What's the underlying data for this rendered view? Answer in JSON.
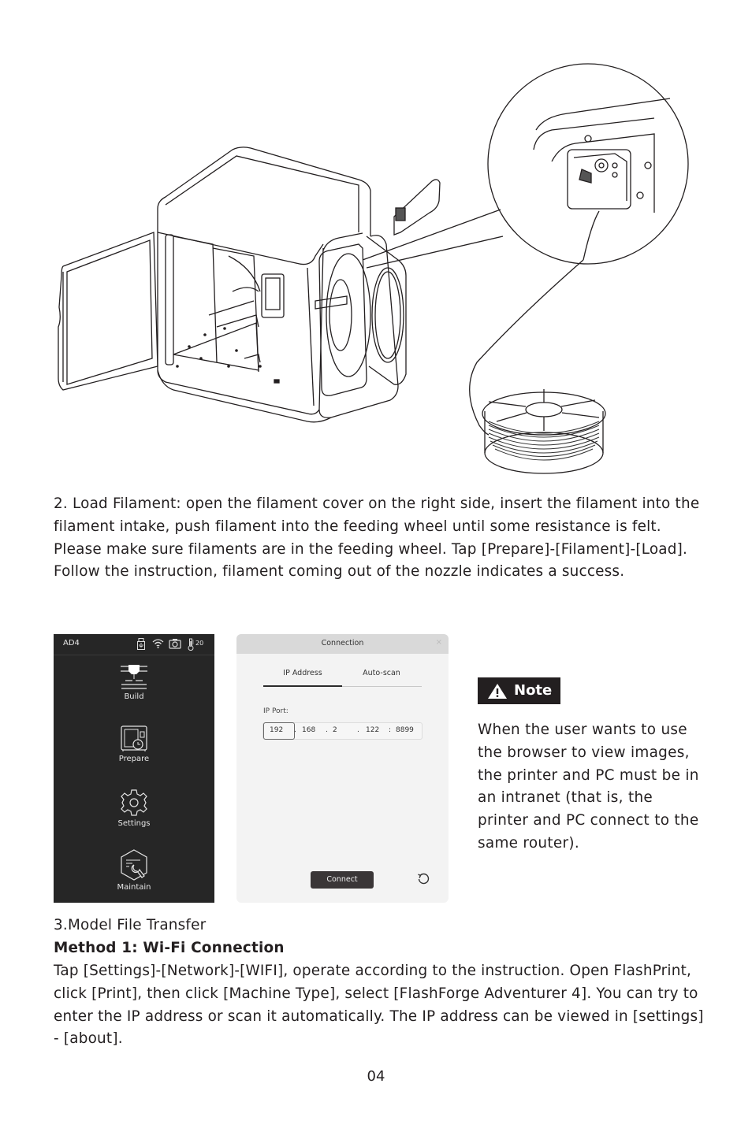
{
  "instructions": {
    "load_filament": "2. Load Filament: open the filament cover on the right side, insert the filament into the filament intake, push filament into the feeding wheel until some resistance is felt. Please make sure filaments are in the feeding wheel. Tap [Prepare]-[Filament]-[Load]. Follow the instruction, filament coming out of the nozzle indicates a success.",
    "transfer_title": "3.Model File Transfer",
    "method_heading": "Method 1: Wi-Fi Connection",
    "transfer_body": "Tap [Settings]-[Network]-[WIFI], operate according to the instruction. Open FlashPrint, click [Print], then click [Machine Type], select [FlashForge Adventurer 4]. You can try to enter the IP address or scan it automatically. The IP address can be viewed in [settings] - [about]."
  },
  "printer_screen": {
    "device_name": "AD4",
    "status_icons": [
      "usb-icon",
      "wifi-icon",
      "camera-icon",
      "thermometer-icon"
    ],
    "temperature": "20",
    "menu": [
      {
        "label": "Build",
        "icon": "build-icon"
      },
      {
        "label": "Prepare",
        "icon": "prepare-icon"
      },
      {
        "label": "Settings",
        "icon": "gear-icon"
      },
      {
        "label": "Maintain",
        "icon": "maintain-icon"
      }
    ]
  },
  "connection_dialog": {
    "title": "Connection",
    "close_icon": "×",
    "tabs": [
      {
        "label": "IP Address",
        "active": true
      },
      {
        "label": "Auto-scan",
        "active": false
      }
    ],
    "ip_label": "IP Port:",
    "ip": {
      "seg1": "192",
      "seg2": "168",
      "seg3": "2",
      "seg4": "122",
      "port": "8899",
      "dot": ".",
      "colon": ":"
    },
    "connect_label": "Connect",
    "refresh_icon": "refresh-icon"
  },
  "note": {
    "label": "Note",
    "icon": "warning-icon",
    "text": "When the user wants to use the browser to view images, the printer and PC must be in an intranet (that is, the printer and PC connect to the same router)."
  },
  "page_number": "04",
  "colors": {
    "text": "#231f20",
    "screen_bg": "#262626",
    "dialog_bg": "#f3f3f3",
    "dialog_header": "#d9d9d9",
    "button_bg": "#3a3637",
    "note_bg": "#231f20"
  }
}
